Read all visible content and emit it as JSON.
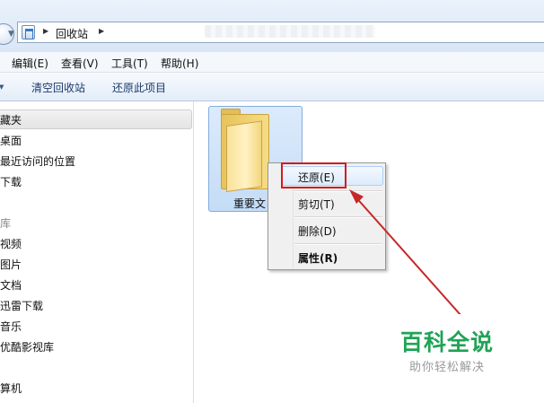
{
  "address_bar": {
    "location": "回收站"
  },
  "menubar": {
    "items": [
      "编辑(E)",
      "查看(V)",
      "工具(T)",
      "帮助(H)"
    ]
  },
  "commandbar": {
    "items": [
      "清空回收站",
      "还原此项目"
    ]
  },
  "navpane": {
    "favorites_header": "藏夹",
    "items": [
      "桌面",
      "最近访问的位置",
      "下载",
      "",
      "视频",
      "图片",
      "文档",
      "迅雷下载",
      "音乐",
      "优酷影视库",
      "",
      "算机"
    ]
  },
  "file": {
    "label": "重要文",
    "icon": "folder-icon"
  },
  "context_menu": {
    "items": [
      "还原(E)",
      "剪切(T)",
      "删除(D)",
      "属性(R)"
    ],
    "highlighted_index": 0
  },
  "annotation": {
    "color": "#d21c1c"
  },
  "watermark": {
    "title": "百科全说",
    "subtitle": "助你轻松解决",
    "color": "#20a356"
  }
}
